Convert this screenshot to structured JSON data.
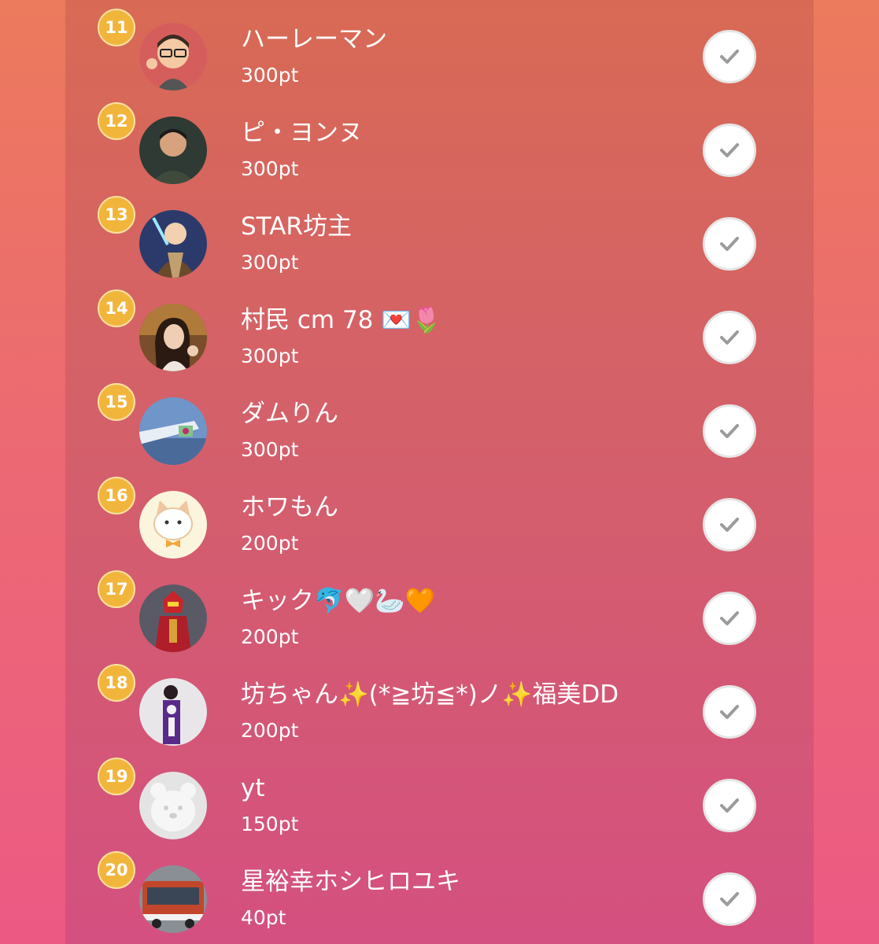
{
  "ranking": [
    {
      "rank": "11",
      "name": "ハーレーマン",
      "points": "300pt",
      "avatar": "memoji-glasses-avatar"
    },
    {
      "rank": "12",
      "name": "ピ・ヨンヌ",
      "points": "300pt",
      "avatar": "man-photo-avatar"
    },
    {
      "rank": "13",
      "name": "STAR坊主",
      "points": "300pt",
      "avatar": "monk-lightsaber-avatar"
    },
    {
      "rank": "14",
      "name": "村民 cm 78 💌🌷",
      "points": "300pt",
      "avatar": "woman-photo-avatar"
    },
    {
      "rank": "15",
      "name": "ダムりん",
      "points": "300pt",
      "avatar": "airplane-wing-avatar"
    },
    {
      "rank": "16",
      "name": "ホワもん",
      "points": "200pt",
      "avatar": "cat-illustration-avatar"
    },
    {
      "rank": "17",
      "name": "キック🐬🤍🦢🧡",
      "points": "200pt",
      "avatar": "hero-figure-avatar"
    },
    {
      "rank": "18",
      "name": "坊ちゃん✨(*≧坊≦*)ノ✨福美DD",
      "points": "200pt",
      "avatar": "banner-photo-avatar"
    },
    {
      "rank": "19",
      "name": "yt",
      "points": "150pt",
      "avatar": "default-bear-avatar"
    },
    {
      "rank": "20",
      "name": "星裕幸ホシヒロユキ",
      "points": "40pt",
      "avatar": "bus-photo-avatar"
    }
  ],
  "colors": {
    "rank_badge": "#f2b53c",
    "check_icon": "#9b9b9b"
  }
}
